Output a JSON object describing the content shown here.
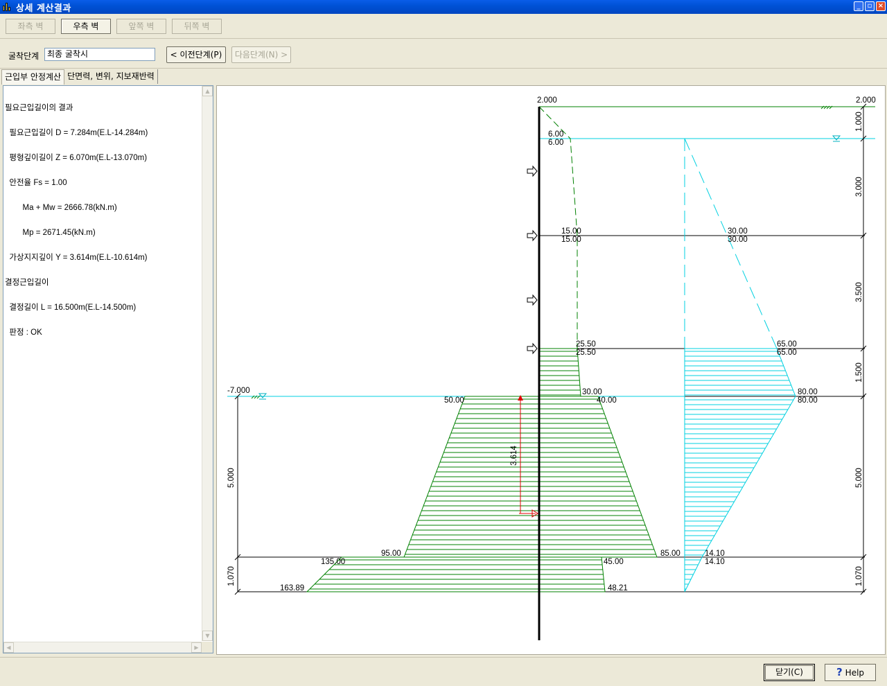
{
  "window": {
    "title": "상세 계산결과"
  },
  "wall_tabs": [
    "좌측 벽",
    "우측 벽",
    "앞쪽 벽",
    "뒤쪽 벽"
  ],
  "stage": {
    "label": "굴착단계",
    "value": "최종 굴착시",
    "prev": "< 이전단계(P)",
    "next": "다음단계(N) >"
  },
  "tabs": [
    "근입부 안정계산",
    "단면력, 변위, 지보재반력"
  ],
  "results": {
    "lines": [
      "필요근입길이의 결과",
      "  필요근입길이 D = 7.284m(E.L-14.284m)",
      "  평형깊이길이 Z = 6.070m(E.L-13.070m)",
      "  안전율 Fs = 1.00",
      "        Ma + Mw = 2666.78(kN.m)",
      "        Mp = 2671.45(kN.m)",
      "  가상지지깊이 Y = 3.614m(E.L-10.614m)",
      "결정근입길이",
      "  결정길이 L = 16.500m(E.L-14.500m)",
      "  판정 : OK"
    ]
  },
  "diagram": {
    "elev_top_left": "2.000",
    "elev_top_right": "2.000",
    "elev_excavation": "-7.000",
    "press_top": [
      "6.00",
      "6.00"
    ],
    "press_a": [
      "15.00",
      "15.00"
    ],
    "press_b": [
      "25.50",
      "25.50"
    ],
    "press_c": [
      "30.00",
      "40.00"
    ],
    "press_d": [
      "45.00",
      "48.21"
    ],
    "passive_top": "50.00",
    "passive_mid": "95.00",
    "passive_a": "135.00",
    "passive_bottom": "163.89",
    "water_a": [
      "30.00",
      "30.00"
    ],
    "water_b": [
      "65.00",
      "65.00"
    ],
    "water_c": [
      "80.00",
      "80.00"
    ],
    "water_d": [
      "14.10",
      "14.10"
    ],
    "water_left": "85.00",
    "virtual_support": "3.614",
    "dims_right": [
      "1.000",
      "3.000",
      "3.500",
      "1.500",
      "5.000",
      "1.070"
    ],
    "dims_left": [
      "5.000",
      "1.070"
    ]
  },
  "buttons": {
    "close": "닫기(C)",
    "help": "Help"
  }
}
